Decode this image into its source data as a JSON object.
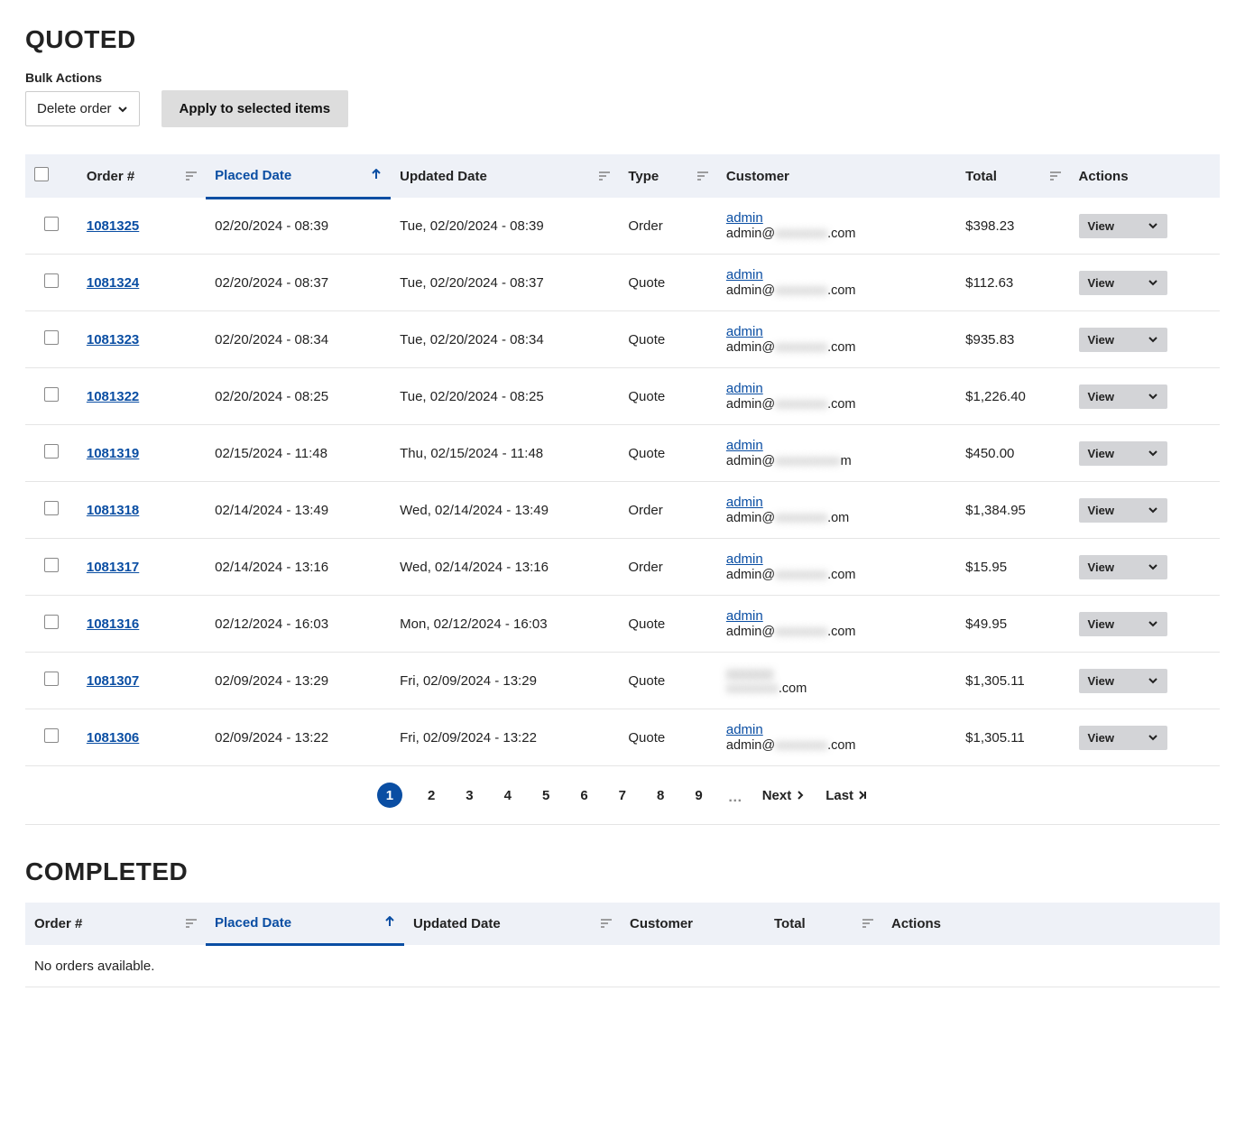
{
  "quoted": {
    "title": "QUOTED",
    "bulk_label": "Bulk Actions",
    "bulk_select_value": "Delete order",
    "apply_btn": "Apply to selected items",
    "columns": {
      "order": "Order #",
      "placed": "Placed Date",
      "updated": "Updated Date",
      "type": "Type",
      "customer": "Customer",
      "total": "Total",
      "actions": "Actions"
    },
    "view_label": "View",
    "rows": [
      {
        "order": "1081325",
        "placed": "02/20/2024 - 08:39",
        "updated": "Tue, 02/20/2024 - 08:39",
        "type": "Order",
        "customer_name": "admin",
        "customer_email_prefix": "admin@",
        "customer_email_blur": "xxxxxxxx",
        "customer_email_suffix": ".com",
        "total": "$398.23"
      },
      {
        "order": "1081324",
        "placed": "02/20/2024 - 08:37",
        "updated": "Tue, 02/20/2024 - 08:37",
        "type": "Quote",
        "customer_name": "admin",
        "customer_email_prefix": "admin@",
        "customer_email_blur": "xxxxxxxx",
        "customer_email_suffix": ".com",
        "total": "$112.63"
      },
      {
        "order": "1081323",
        "placed": "02/20/2024 - 08:34",
        "updated": "Tue, 02/20/2024 - 08:34",
        "type": "Quote",
        "customer_name": "admin",
        "customer_email_prefix": "admin@",
        "customer_email_blur": "xxxxxxxx",
        "customer_email_suffix": ".com",
        "total": "$935.83"
      },
      {
        "order": "1081322",
        "placed": "02/20/2024 - 08:25",
        "updated": "Tue, 02/20/2024 - 08:25",
        "type": "Quote",
        "customer_name": "admin",
        "customer_email_prefix": "admin@",
        "customer_email_blur": "xxxxxxxx",
        "customer_email_suffix": ".com",
        "total": "$1,226.40"
      },
      {
        "order": "1081319",
        "placed": "02/15/2024 - 11:48",
        "updated": "Thu, 02/15/2024 - 11:48",
        "type": "Quote",
        "customer_name": "admin",
        "customer_email_prefix": "admin@",
        "customer_email_blur": "xxxxxxxxxx",
        "customer_email_suffix": "m",
        "total": "$450.00"
      },
      {
        "order": "1081318",
        "placed": "02/14/2024 - 13:49",
        "updated": "Wed, 02/14/2024 - 13:49",
        "type": "Order",
        "customer_name": "admin",
        "customer_email_prefix": "admin@",
        "customer_email_blur": "xxxxxxxx",
        "customer_email_suffix": ".om",
        "total": "$1,384.95"
      },
      {
        "order": "1081317",
        "placed": "02/14/2024 - 13:16",
        "updated": "Wed, 02/14/2024 - 13:16",
        "type": "Order",
        "customer_name": "admin",
        "customer_email_prefix": "admin@",
        "customer_email_blur": "xxxxxxxx",
        "customer_email_suffix": ".com",
        "total": "$15.95"
      },
      {
        "order": "1081316",
        "placed": "02/12/2024 - 16:03",
        "updated": "Mon, 02/12/2024 - 16:03",
        "type": "Quote",
        "customer_name": "admin",
        "customer_email_prefix": "admin@",
        "customer_email_blur": "xxxxxxxx",
        "customer_email_suffix": ".com",
        "total": "$49.95"
      },
      {
        "order": "1081307",
        "placed": "02/09/2024 - 13:29",
        "updated": "Fri, 02/09/2024 - 13:29",
        "type": "Quote",
        "customer_name": "",
        "customer_name_blur": "xxxxxxx",
        "customer_email_prefix": "",
        "customer_email_blur": "xxxxxxxx",
        "customer_email_suffix": ".com",
        "total": "$1,305.11"
      },
      {
        "order": "1081306",
        "placed": "02/09/2024 - 13:22",
        "updated": "Fri, 02/09/2024 - 13:22",
        "type": "Quote",
        "customer_name": "admin",
        "customer_email_prefix": "admin@",
        "customer_email_blur": "xxxxxxxx",
        "customer_email_suffix": ".com",
        "total": "$1,305.11"
      }
    ],
    "pagination": {
      "pages": [
        "1",
        "2",
        "3",
        "4",
        "5",
        "6",
        "7",
        "8",
        "9"
      ],
      "current": 1,
      "ellipsis": "…",
      "next": "Next",
      "last": "Last"
    }
  },
  "completed": {
    "title": "COMPLETED",
    "columns": {
      "order": "Order #",
      "placed": "Placed Date",
      "updated": "Updated Date",
      "customer": "Customer",
      "total": "Total",
      "actions": "Actions"
    },
    "empty": "No orders available."
  }
}
